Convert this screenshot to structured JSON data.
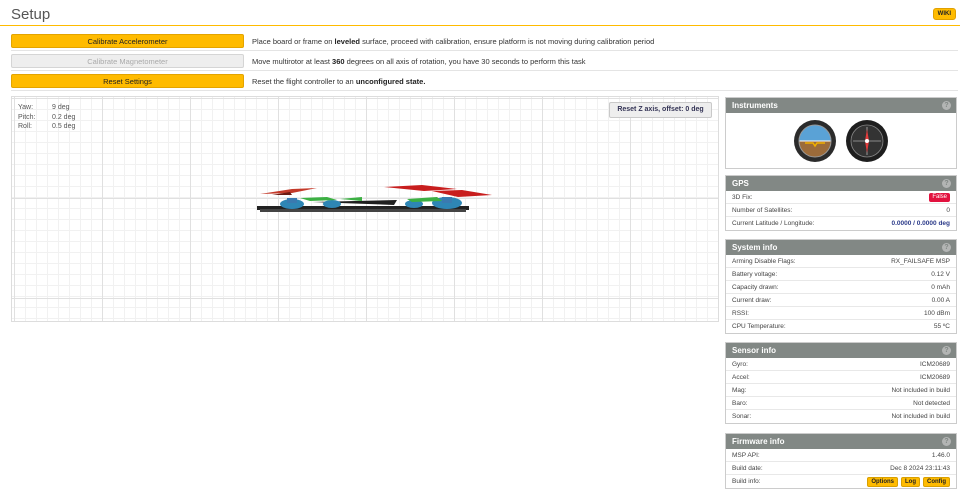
{
  "header": {
    "title": "Setup",
    "wiki_label": "WIKI"
  },
  "calibration": [
    {
      "button": "Calibrate Accelerometer",
      "desc_pre": "Place board or frame on ",
      "desc_bold": "leveled",
      "desc_post": " surface, proceed with calibration, ensure platform is not moving during calibration period",
      "enabled": true
    },
    {
      "button": "Calibrate Magnetometer",
      "desc_pre": "Move multirotor at least ",
      "desc_bold": "360",
      "desc_post": " degrees on all axis of rotation, you have 30 seconds to perform this task",
      "enabled": false
    },
    {
      "button": "Reset Settings",
      "desc_pre": "Reset the flight controller to an ",
      "desc_bold": "unconfigured state.",
      "desc_post": "",
      "enabled": true
    }
  ],
  "attitude": {
    "yaw_label": "Yaw:",
    "yaw": "9 deg",
    "pitch_label": "Pitch:",
    "pitch": "0.2 deg",
    "roll_label": "Roll:",
    "roll": "0.5 deg"
  },
  "reset_z_label": "Reset Z axis, offset: 0 deg",
  "instruments": {
    "title": "Instruments",
    "help": "?"
  },
  "gps": {
    "title": "GPS",
    "rows": [
      {
        "label": "3D Fix:",
        "value": "False"
      },
      {
        "label": "Number of Satellites:",
        "value": "0"
      },
      {
        "label": "Current Latitude / Longitude:",
        "value": "0.0000 / 0.0000 deg"
      }
    ]
  },
  "system_info": {
    "title": "System info",
    "rows": [
      {
        "label": "Arming Disable Flags:",
        "value": "RX_FAILSAFE  MSP"
      },
      {
        "label": "Battery voltage:",
        "value": "0.12 V"
      },
      {
        "label": "Capacity drawn:",
        "value": "0 mAh"
      },
      {
        "label": "Current draw:",
        "value": "0.00 A"
      },
      {
        "label": "RSSI:",
        "value": "100 dBm"
      },
      {
        "label": "CPU Temperature:",
        "value": "55 ºC"
      }
    ]
  },
  "sensor_info": {
    "title": "Sensor info",
    "rows": [
      {
        "label": "Gyro:",
        "value": "ICM20689"
      },
      {
        "label": "Accel:",
        "value": "ICM20689"
      },
      {
        "label": "Mag:",
        "value": "Not included in build"
      },
      {
        "label": "Baro:",
        "value": "Not detected"
      },
      {
        "label": "Sonar:",
        "value": "Not included in build"
      }
    ]
  },
  "firmware_info": {
    "title": "Firmware info",
    "rows": [
      {
        "label": "MSP API:",
        "value": "1.46.0"
      },
      {
        "label": "Build date:",
        "value": "Dec 8 2024 23:11:43"
      }
    ],
    "build_info_label": "Build info:",
    "build_buttons": [
      "Options",
      "Log",
      "Config"
    ]
  },
  "colors": {
    "accent": "#ffbb00",
    "panel_header": "#828885",
    "false_badge": "#e2123f",
    "value_blue": "#2b3a89"
  }
}
